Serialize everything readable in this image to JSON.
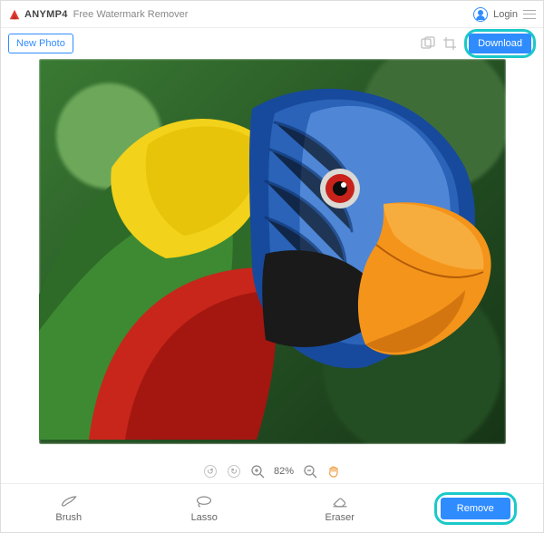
{
  "header": {
    "brand": "ANYMP4",
    "app_title": "Free Watermark Remover",
    "login_label": "Login"
  },
  "toolbar": {
    "new_photo_label": "New Photo",
    "download_label": "Download"
  },
  "zoom": {
    "value_label": "82%"
  },
  "tools": {
    "brush_label": "Brush",
    "lasso_label": "Lasso",
    "eraser_label": "Eraser",
    "remove_label": "Remove"
  },
  "highlight_color": "#1bc9c9",
  "accent_color": "#2f8cff"
}
